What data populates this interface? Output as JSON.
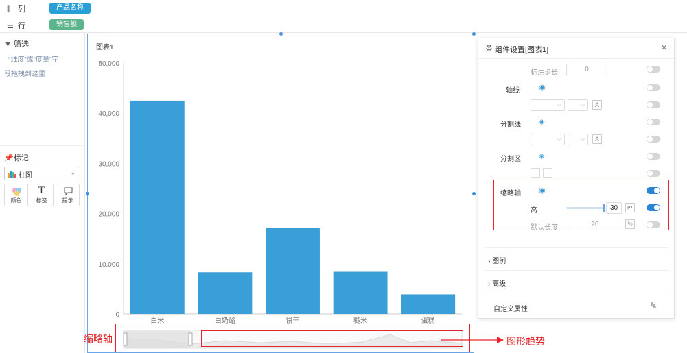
{
  "columns": {
    "label": "列",
    "icon": "columns-icon",
    "pill": "产品名称",
    "pill_color": "#2a9fd6"
  },
  "rows": {
    "label": "行",
    "icon": "rows-icon",
    "pill": "销售额",
    "pill_color": "#5cb58c"
  },
  "filter": {
    "title": "筛选",
    "hint_line1": "“维度”或“度量”字",
    "hint_line2": "段拖拽到这里"
  },
  "marks": {
    "title": "标记",
    "chart_type": "柱图",
    "buttons": [
      {
        "label": "颜色",
        "icon": "color-icon"
      },
      {
        "label": "标签",
        "icon": "text-T-icon",
        "glyph": "T"
      },
      {
        "label": "提示",
        "icon": "tooltip-icon"
      }
    ]
  },
  "chart_title": "图表1",
  "chart_data": {
    "type": "bar",
    "categories": [
      "白米",
      "白奶酪",
      "饼干",
      "糙米",
      "蛋糕"
    ],
    "values": [
      42500,
      8300,
      17100,
      8400,
      3900
    ],
    "ylim": [
      0,
      50000
    ],
    "yticks": [
      "0",
      "10,000",
      "20,000",
      "30,000",
      "40,000",
      "50,000"
    ],
    "bar_color": "#3a9ed8",
    "grid": false
  },
  "panel": {
    "title": "组件设置[图表1]",
    "rows": {
      "label_step": "标注步长",
      "label_step_value": "0",
      "axis_line": "轴线",
      "split_line": "分割线",
      "split_area": "分割区",
      "thumbnail_axis": "缩略轴",
      "height": "高",
      "height_value": "30",
      "height_unit": "px",
      "default_length": "默认长度",
      "default_length_value": "20",
      "default_length_unit": "%"
    },
    "sections": [
      "图例",
      "高级"
    ],
    "custom_props": "自定义属性"
  },
  "annotations": {
    "thumbnail_axis": "缩略轴",
    "graph_trend": "图形趋势",
    "accent": "#e5252a"
  }
}
